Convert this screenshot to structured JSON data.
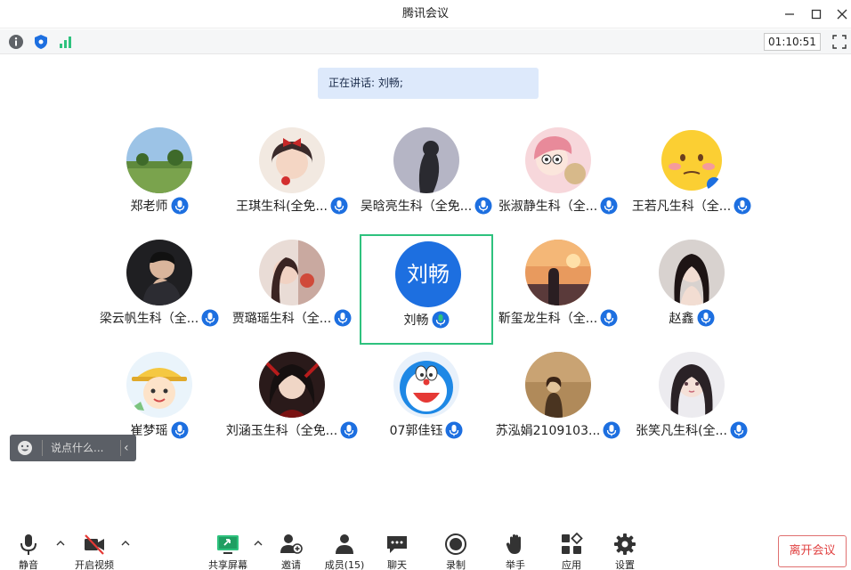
{
  "window": {
    "title": "腾讯会议"
  },
  "status": {
    "timer": "01:10:51"
  },
  "speaking": {
    "text": "正在讲话: 刘畅;"
  },
  "participants": [
    {
      "name": "郑老师",
      "row": 0,
      "col": 0,
      "avatar": "landscape"
    },
    {
      "name": "王琪生科(全免...",
      "row": 0,
      "col": 1,
      "avatar": "girl-bow"
    },
    {
      "name": "吴晗亮生科（全免...",
      "row": 0,
      "col": 2,
      "avatar": "silhouette"
    },
    {
      "name": "张淑静生科（全...",
      "row": 0,
      "col": 3,
      "avatar": "cartoon-girl"
    },
    {
      "name": "王若凡生科（全...",
      "row": 0,
      "col": 4,
      "avatar": "emoji-face"
    },
    {
      "name": "梁云帆生科（全...",
      "row": 1,
      "col": 0,
      "avatar": "man-portrait"
    },
    {
      "name": "贾璐瑶生科（全...",
      "row": 1,
      "col": 1,
      "avatar": "girl-curtain"
    },
    {
      "name": "刘畅",
      "row": 1,
      "col": 2,
      "avatar": "text",
      "avatar_text": "刘畅",
      "active": true
    },
    {
      "name": "靳玺龙生科（全...",
      "row": 1,
      "col": 3,
      "avatar": "sunset"
    },
    {
      "name": "赵鑫",
      "row": 1,
      "col": 4,
      "avatar": "woman-portrait"
    },
    {
      "name": "崔梦瑶",
      "row": 2,
      "col": 0,
      "avatar": "cartoon-hat"
    },
    {
      "name": "刘涵玉生科（全免...",
      "row": 2,
      "col": 1,
      "avatar": "anime-dark"
    },
    {
      "name": "07郭佳钰",
      "row": 2,
      "col": 2,
      "avatar": "doraemon"
    },
    {
      "name": "苏泓娟2109103...",
      "row": 2,
      "col": 3,
      "avatar": "sepia-girl"
    },
    {
      "name": "张笑凡生科(全...",
      "row": 2,
      "col": 4,
      "avatar": "anime-girl"
    }
  ],
  "chat_input": {
    "placeholder": "说点什么..."
  },
  "toolbar": {
    "mute": "静音",
    "video": "开启视频",
    "share": "共享屏幕",
    "invite": "邀请",
    "members": "成员(15)",
    "chat": "聊天",
    "record": "录制",
    "raise_hand": "举手",
    "apps": "应用",
    "settings": "设置",
    "leave": "离开会议"
  },
  "colors": {
    "accent_blue": "#1d6fe0",
    "active_border": "#2ec27e",
    "leave_red": "#e04040",
    "speaking_bg": "#dde9fb"
  }
}
